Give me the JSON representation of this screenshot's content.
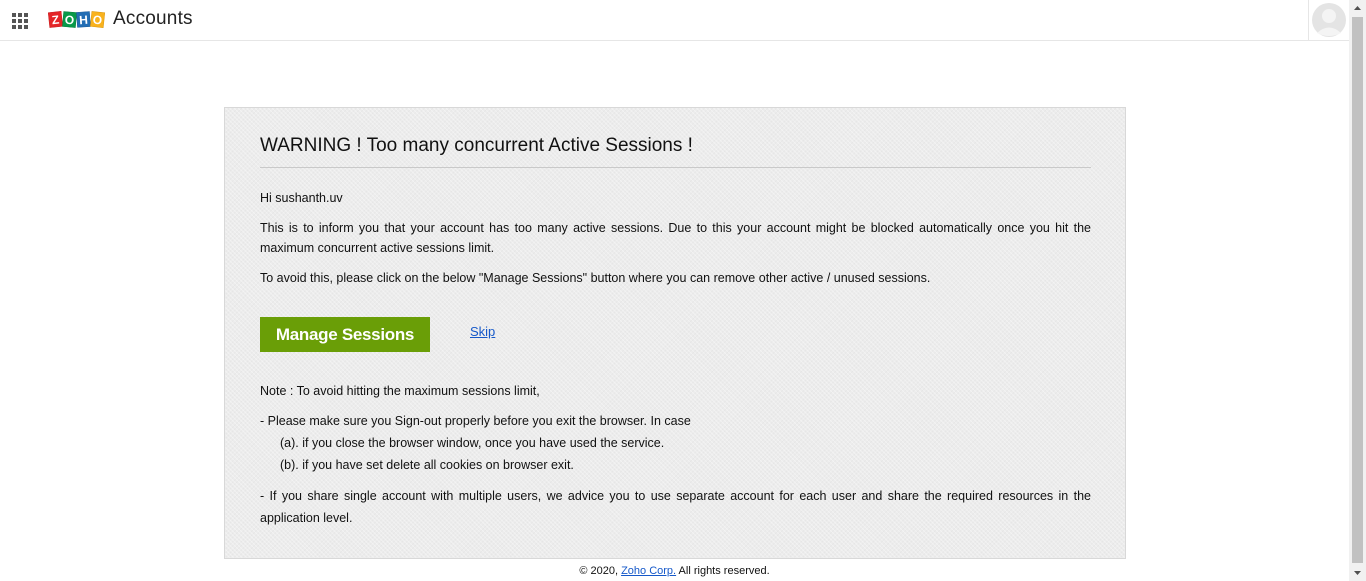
{
  "header": {
    "app_title": "Accounts",
    "logo_letters": [
      "Z",
      "O",
      "H",
      "O"
    ],
    "logo_colors": [
      "#e42527",
      "#089949",
      "#226db4",
      "#f9b21d"
    ]
  },
  "panel": {
    "title": "WARNING ! Too many concurrent Active Sessions !",
    "greeting": "Hi sushanth.uv",
    "paragraph1": "This is to inform you that your account has too many active sessions. Due to this your account might be blocked automatically once you hit the maximum concurrent active sessions limit.",
    "paragraph2": "To avoid this, please click on the below \"Manage Sessions\" button where you can remove other active / unused sessions.",
    "manage_button_label": "Manage Sessions",
    "skip_label": "Skip",
    "note": "Note : To avoid hitting the maximum sessions limit,",
    "bullet1": "- Please make sure you Sign-out properly before you exit the browser. In case",
    "bullet1_sub_a": "(a). if you close the browser window, once you have used the service.",
    "bullet1_sub_b": "(b). if you have set delete all cookies on browser exit.",
    "bullet2": "- If you share single account with multiple users, we advice you to use separate account for each user and share the required resources in the application level."
  },
  "footer": {
    "prefix": "© 2020, ",
    "link": "Zoho Corp.",
    "suffix": " All rights reserved."
  },
  "colors": {
    "button_green": "#6a9e07",
    "link_blue": "#1558c9",
    "panel_bg": "#ececec"
  }
}
